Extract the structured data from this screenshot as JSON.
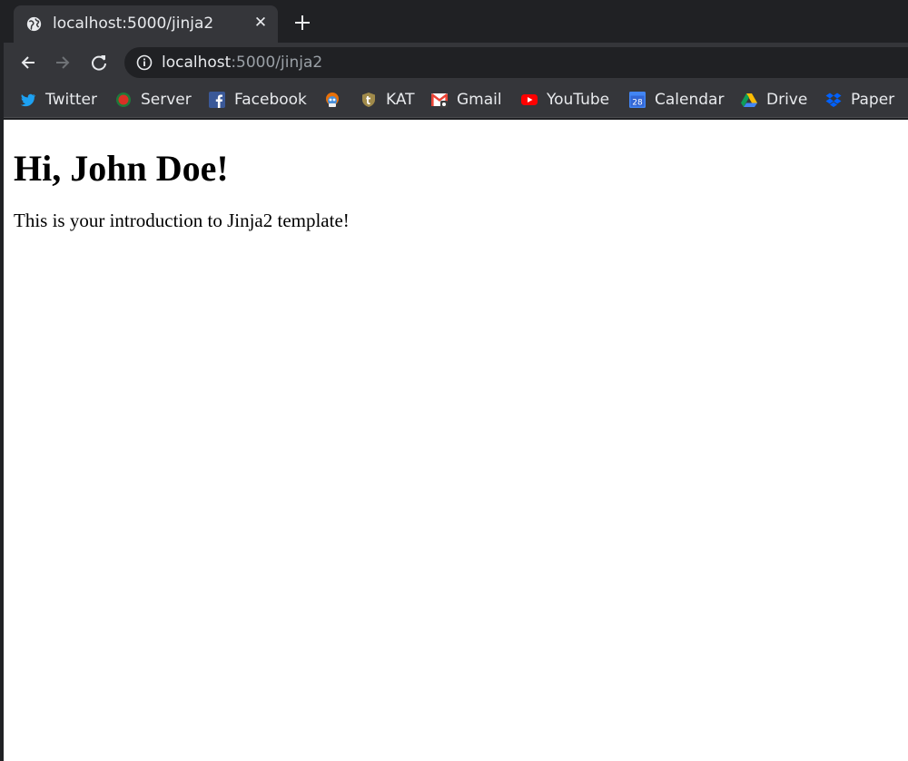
{
  "browser": {
    "tab": {
      "title": "localhost:5000/jinja2",
      "close_glyph": "✕",
      "favicon": "globe-icon"
    },
    "toolbar": {
      "url_host": "localhost",
      "url_rest": ":5000/jinja2",
      "icons": [
        "back-arrow-icon",
        "forward-arrow-icon",
        "reload-icon",
        "info-icon"
      ]
    },
    "bookmarks": [
      {
        "label": "Twitter",
        "icon": "twitter-icon",
        "color": "#1da1f2"
      },
      {
        "label": "Server",
        "icon": "server-icon",
        "color": "#d93025"
      },
      {
        "label": "Facebook",
        "icon": "facebook-icon",
        "color": "#3b5998"
      },
      {
        "label": "",
        "icon": "mascot-icon",
        "color": "#e8710a"
      },
      {
        "label": "KAT",
        "icon": "kat-icon",
        "color": "#a08a4a"
      },
      {
        "label": "Gmail",
        "icon": "gmail-icon",
        "color": "#ea4335"
      },
      {
        "label": "YouTube",
        "icon": "youtube-icon",
        "color": "#ff0000"
      },
      {
        "label": "Calendar",
        "icon": "calendar-icon",
        "color": "#4285f4",
        "day": "28"
      },
      {
        "label": "Drive",
        "icon": "drive-icon",
        "color": "#0f9d58"
      },
      {
        "label": "Paper",
        "icon": "dropbox-icon",
        "color": "#0061ff"
      }
    ]
  },
  "page": {
    "heading": "Hi, John Doe!",
    "intro": "This is your introduction to Jinja2 template!"
  }
}
